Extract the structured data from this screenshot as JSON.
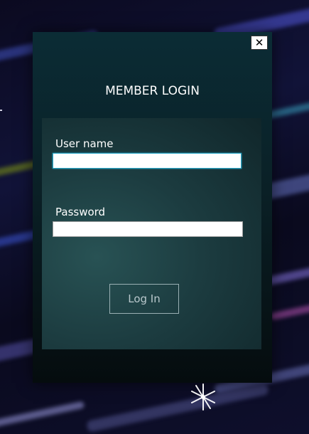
{
  "dialog": {
    "title": "MEMBER LOGIN",
    "close_label": "✕"
  },
  "form": {
    "username_label": "User name",
    "username_value": "",
    "password_label": "Password",
    "password_value": "",
    "login_label": "Log In"
  },
  "colors": {
    "panel": "#0a2026",
    "inner_panel": "#1c3c40",
    "focus_border": "#2aa8c8",
    "button_text": "#b9c8cc"
  },
  "icons": {
    "close": "close-icon",
    "sparkle": "sparkle-icon"
  }
}
